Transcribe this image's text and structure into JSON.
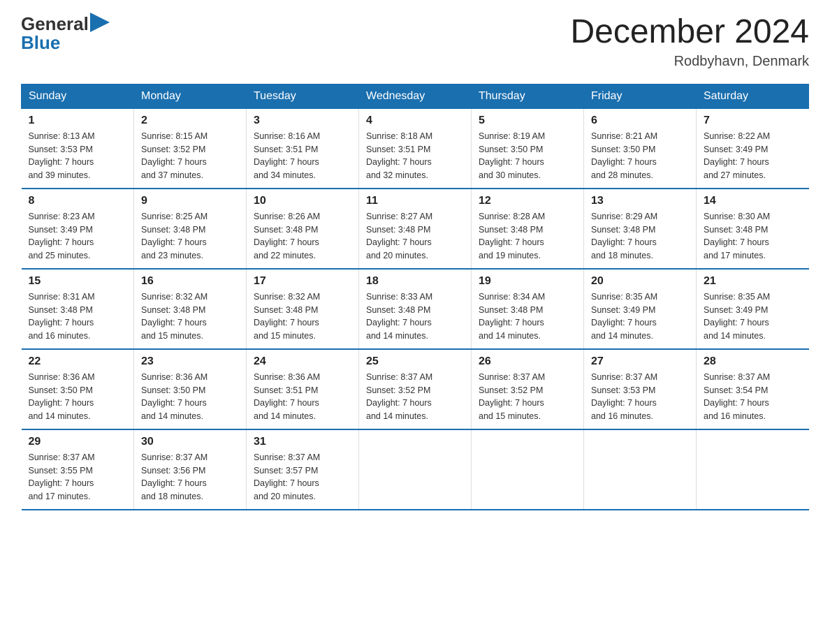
{
  "header": {
    "logo_text_general": "General",
    "logo_text_blue": "Blue",
    "month_title": "December 2024",
    "location": "Rodbyhavn, Denmark"
  },
  "days_of_week": [
    "Sunday",
    "Monday",
    "Tuesday",
    "Wednesday",
    "Thursday",
    "Friday",
    "Saturday"
  ],
  "weeks": [
    [
      {
        "day": "1",
        "sunrise": "Sunrise: 8:13 AM",
        "sunset": "Sunset: 3:53 PM",
        "daylight": "Daylight: 7 hours",
        "daylight2": "and 39 minutes."
      },
      {
        "day": "2",
        "sunrise": "Sunrise: 8:15 AM",
        "sunset": "Sunset: 3:52 PM",
        "daylight": "Daylight: 7 hours",
        "daylight2": "and 37 minutes."
      },
      {
        "day": "3",
        "sunrise": "Sunrise: 8:16 AM",
        "sunset": "Sunset: 3:51 PM",
        "daylight": "Daylight: 7 hours",
        "daylight2": "and 34 minutes."
      },
      {
        "day": "4",
        "sunrise": "Sunrise: 8:18 AM",
        "sunset": "Sunset: 3:51 PM",
        "daylight": "Daylight: 7 hours",
        "daylight2": "and 32 minutes."
      },
      {
        "day": "5",
        "sunrise": "Sunrise: 8:19 AM",
        "sunset": "Sunset: 3:50 PM",
        "daylight": "Daylight: 7 hours",
        "daylight2": "and 30 minutes."
      },
      {
        "day": "6",
        "sunrise": "Sunrise: 8:21 AM",
        "sunset": "Sunset: 3:50 PM",
        "daylight": "Daylight: 7 hours",
        "daylight2": "and 28 minutes."
      },
      {
        "day": "7",
        "sunrise": "Sunrise: 8:22 AM",
        "sunset": "Sunset: 3:49 PM",
        "daylight": "Daylight: 7 hours",
        "daylight2": "and 27 minutes."
      }
    ],
    [
      {
        "day": "8",
        "sunrise": "Sunrise: 8:23 AM",
        "sunset": "Sunset: 3:49 PM",
        "daylight": "Daylight: 7 hours",
        "daylight2": "and 25 minutes."
      },
      {
        "day": "9",
        "sunrise": "Sunrise: 8:25 AM",
        "sunset": "Sunset: 3:48 PM",
        "daylight": "Daylight: 7 hours",
        "daylight2": "and 23 minutes."
      },
      {
        "day": "10",
        "sunrise": "Sunrise: 8:26 AM",
        "sunset": "Sunset: 3:48 PM",
        "daylight": "Daylight: 7 hours",
        "daylight2": "and 22 minutes."
      },
      {
        "day": "11",
        "sunrise": "Sunrise: 8:27 AM",
        "sunset": "Sunset: 3:48 PM",
        "daylight": "Daylight: 7 hours",
        "daylight2": "and 20 minutes."
      },
      {
        "day": "12",
        "sunrise": "Sunrise: 8:28 AM",
        "sunset": "Sunset: 3:48 PM",
        "daylight": "Daylight: 7 hours",
        "daylight2": "and 19 minutes."
      },
      {
        "day": "13",
        "sunrise": "Sunrise: 8:29 AM",
        "sunset": "Sunset: 3:48 PM",
        "daylight": "Daylight: 7 hours",
        "daylight2": "and 18 minutes."
      },
      {
        "day": "14",
        "sunrise": "Sunrise: 8:30 AM",
        "sunset": "Sunset: 3:48 PM",
        "daylight": "Daylight: 7 hours",
        "daylight2": "and 17 minutes."
      }
    ],
    [
      {
        "day": "15",
        "sunrise": "Sunrise: 8:31 AM",
        "sunset": "Sunset: 3:48 PM",
        "daylight": "Daylight: 7 hours",
        "daylight2": "and 16 minutes."
      },
      {
        "day": "16",
        "sunrise": "Sunrise: 8:32 AM",
        "sunset": "Sunset: 3:48 PM",
        "daylight": "Daylight: 7 hours",
        "daylight2": "and 15 minutes."
      },
      {
        "day": "17",
        "sunrise": "Sunrise: 8:32 AM",
        "sunset": "Sunset: 3:48 PM",
        "daylight": "Daylight: 7 hours",
        "daylight2": "and 15 minutes."
      },
      {
        "day": "18",
        "sunrise": "Sunrise: 8:33 AM",
        "sunset": "Sunset: 3:48 PM",
        "daylight": "Daylight: 7 hours",
        "daylight2": "and 14 minutes."
      },
      {
        "day": "19",
        "sunrise": "Sunrise: 8:34 AM",
        "sunset": "Sunset: 3:48 PM",
        "daylight": "Daylight: 7 hours",
        "daylight2": "and 14 minutes."
      },
      {
        "day": "20",
        "sunrise": "Sunrise: 8:35 AM",
        "sunset": "Sunset: 3:49 PM",
        "daylight": "Daylight: 7 hours",
        "daylight2": "and 14 minutes."
      },
      {
        "day": "21",
        "sunrise": "Sunrise: 8:35 AM",
        "sunset": "Sunset: 3:49 PM",
        "daylight": "Daylight: 7 hours",
        "daylight2": "and 14 minutes."
      }
    ],
    [
      {
        "day": "22",
        "sunrise": "Sunrise: 8:36 AM",
        "sunset": "Sunset: 3:50 PM",
        "daylight": "Daylight: 7 hours",
        "daylight2": "and 14 minutes."
      },
      {
        "day": "23",
        "sunrise": "Sunrise: 8:36 AM",
        "sunset": "Sunset: 3:50 PM",
        "daylight": "Daylight: 7 hours",
        "daylight2": "and 14 minutes."
      },
      {
        "day": "24",
        "sunrise": "Sunrise: 8:36 AM",
        "sunset": "Sunset: 3:51 PM",
        "daylight": "Daylight: 7 hours",
        "daylight2": "and 14 minutes."
      },
      {
        "day": "25",
        "sunrise": "Sunrise: 8:37 AM",
        "sunset": "Sunset: 3:52 PM",
        "daylight": "Daylight: 7 hours",
        "daylight2": "and 14 minutes."
      },
      {
        "day": "26",
        "sunrise": "Sunrise: 8:37 AM",
        "sunset": "Sunset: 3:52 PM",
        "daylight": "Daylight: 7 hours",
        "daylight2": "and 15 minutes."
      },
      {
        "day": "27",
        "sunrise": "Sunrise: 8:37 AM",
        "sunset": "Sunset: 3:53 PM",
        "daylight": "Daylight: 7 hours",
        "daylight2": "and 16 minutes."
      },
      {
        "day": "28",
        "sunrise": "Sunrise: 8:37 AM",
        "sunset": "Sunset: 3:54 PM",
        "daylight": "Daylight: 7 hours",
        "daylight2": "and 16 minutes."
      }
    ],
    [
      {
        "day": "29",
        "sunrise": "Sunrise: 8:37 AM",
        "sunset": "Sunset: 3:55 PM",
        "daylight": "Daylight: 7 hours",
        "daylight2": "and 17 minutes."
      },
      {
        "day": "30",
        "sunrise": "Sunrise: 8:37 AM",
        "sunset": "Sunset: 3:56 PM",
        "daylight": "Daylight: 7 hours",
        "daylight2": "and 18 minutes."
      },
      {
        "day": "31",
        "sunrise": "Sunrise: 8:37 AM",
        "sunset": "Sunset: 3:57 PM",
        "daylight": "Daylight: 7 hours",
        "daylight2": "and 20 minutes."
      },
      null,
      null,
      null,
      null
    ]
  ]
}
